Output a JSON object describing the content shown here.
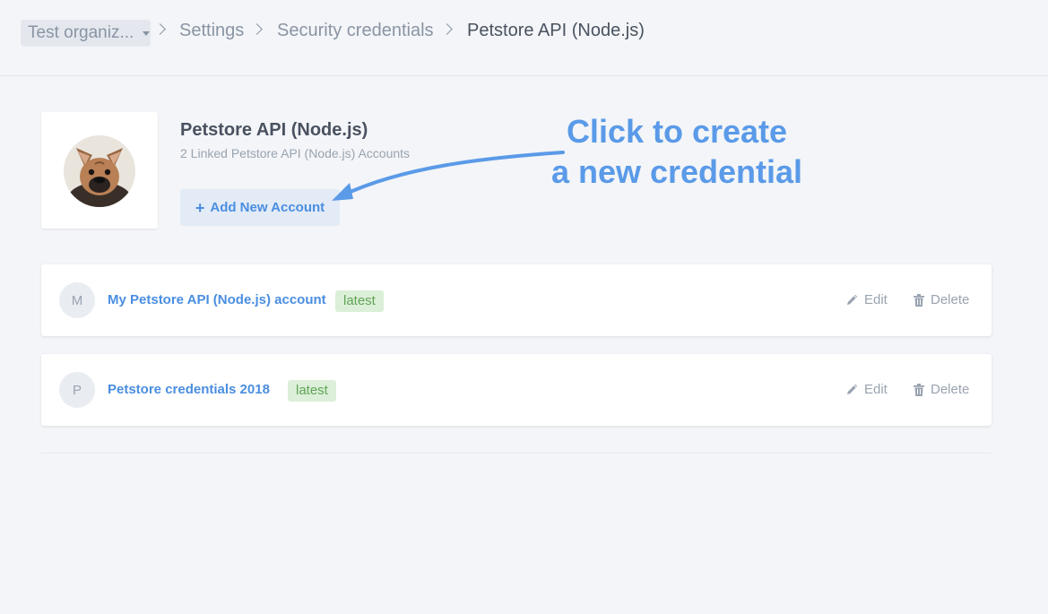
{
  "breadcrumb": {
    "org_label": "Test organiz...",
    "items": [
      "Settings",
      "Security credentials",
      "Petstore API (Node.js)"
    ]
  },
  "service": {
    "title": "Petstore API (Node.js)",
    "subtitle": "2 Linked Petstore API (Node.js) Accounts",
    "add_button_label": "Add New Account",
    "add_button_icon": "plus-icon",
    "logo_icon": "french-bulldog-avatar"
  },
  "annotation": {
    "line1": "Click to create",
    "line2": "a new credential"
  },
  "credentials": [
    {
      "initial": "M",
      "name": "My Petstore API (Node.js) account",
      "badge": "latest",
      "edit_label": "Edit",
      "delete_label": "Delete"
    },
    {
      "initial": "P",
      "name": "Petstore credentials 2018",
      "badge": "latest",
      "edit_label": "Edit",
      "delete_label": "Delete"
    }
  ],
  "colors": {
    "accent": "#4a8ee0",
    "annotation": "#5a9ae8",
    "badge_bg": "#dcefd8",
    "badge_text": "#5fa456",
    "background": "#f3f5f8"
  }
}
